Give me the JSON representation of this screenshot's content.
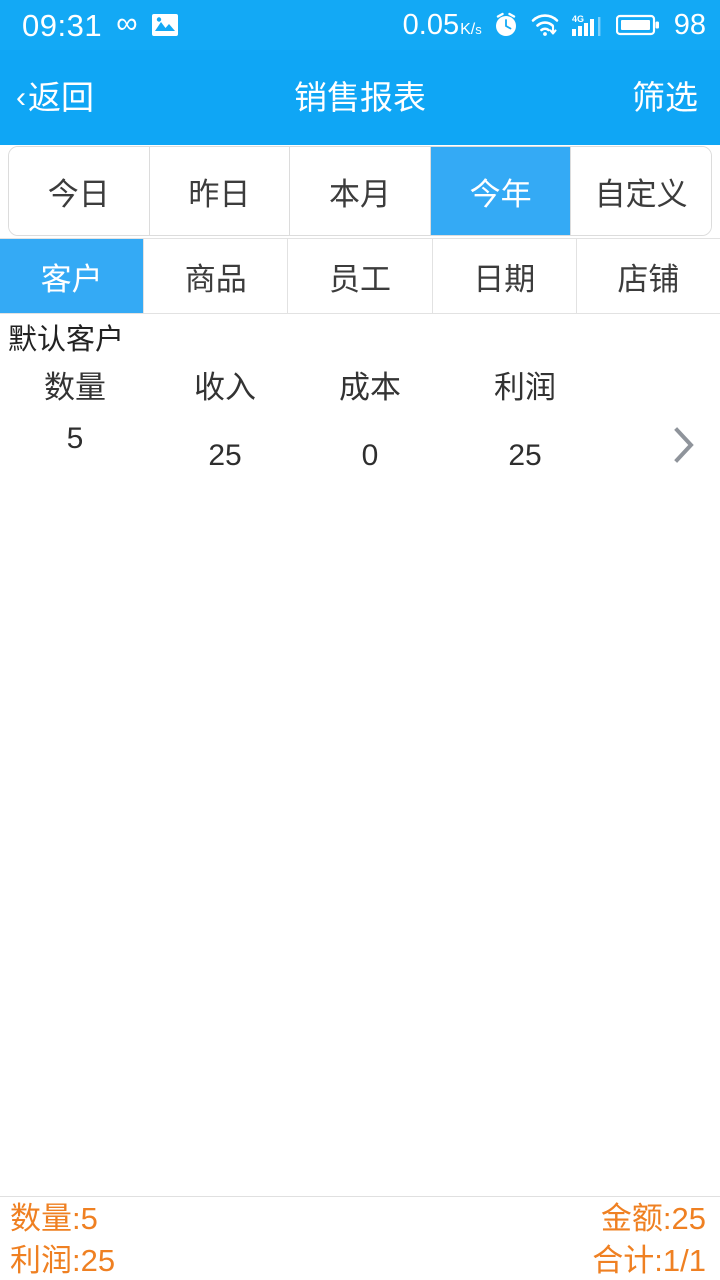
{
  "status_bar": {
    "time": "09:31",
    "infinity_glyph": "∞",
    "gallery_icon": "gallery-icon",
    "net_speed_value": "0.05",
    "net_speed_unit_top": "K",
    "net_speed_unit_bottom": "s",
    "alarm_icon": "alarm-clock-icon",
    "wifi_icon": "wifi-icon",
    "signal_icon": "signal-4g-icon",
    "battery_icon": "battery-icon",
    "battery_level": "98",
    "background_color": "#13a9f5"
  },
  "nav_bar": {
    "back_chevron": "‹",
    "back_label": "返回",
    "title": "销售报表",
    "filter_label": "筛选",
    "background_color": "#0fa6f5"
  },
  "range_tabs": {
    "items": [
      {
        "label": "今日",
        "active": false
      },
      {
        "label": "昨日",
        "active": false
      },
      {
        "label": "本月",
        "active": false
      },
      {
        "label": "今年",
        "active": true
      },
      {
        "label": "自定义",
        "active": false
      }
    ],
    "active_color": "#34aaf5"
  },
  "category_tabs": {
    "items": [
      {
        "label": "客户",
        "active": true
      },
      {
        "label": "商品",
        "active": false
      },
      {
        "label": "员工",
        "active": false
      },
      {
        "label": "日期",
        "active": false
      },
      {
        "label": "店铺",
        "active": false
      }
    ],
    "active_color": "#34aaf5"
  },
  "list": {
    "headers": [
      "数量",
      "收入",
      "成本",
      "利润"
    ],
    "rows": [
      {
        "title": "默认客户",
        "values": [
          "5",
          "25",
          "0",
          "25"
        ],
        "chevron": "chevron-right-icon"
      }
    ]
  },
  "footer": {
    "quantity": "数量:5",
    "amount": "金额:25",
    "profit": "利润:25",
    "total": "合计:1/1",
    "text_color": "#ef8022"
  }
}
